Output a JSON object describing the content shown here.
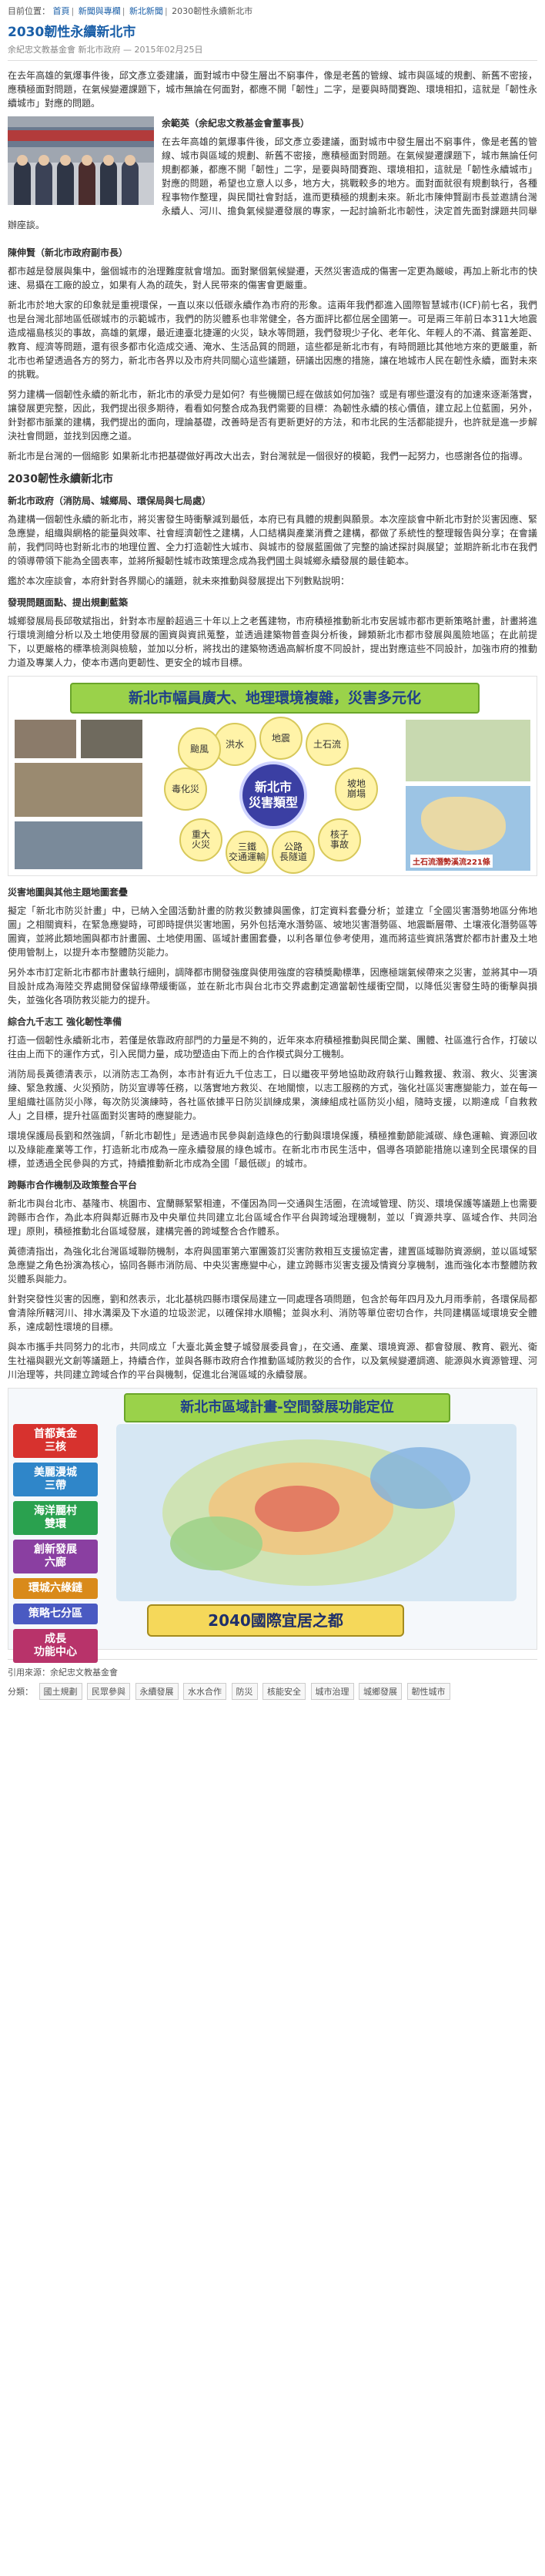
{
  "breadcrumb": {
    "prefix": "目前位置：",
    "items": [
      "首頁",
      "新聞與專欄",
      "新北新聞"
    ],
    "current": "2030韌性永續新北市"
  },
  "article": {
    "title": "2030韌性永續新北市",
    "meta": "余紀忠文教基金會 新北市政府 — 2015年02月25日",
    "intro": "在去年高雄的氣爆事件後，邱文彥立委建議，面對城市中發生層出不窮事件，像是老舊的管線、城市與區域的規劃、新舊不密接，應積極面對問題，在氣候變遷課題下，城市無論在何面對，都應不開「韌性」二字，是要與時間賽跑、環境相扣，這就是「韌性永續城市」對應的問題。",
    "caption": "余範英（余紀忠文教基金會董事長）",
    "para_a": "在去年高雄的氣爆事件後，邱文彥立委建議，面對城市中發生層出不窮事件，像是老舊的管線、城市與區域的規劃、新舊不密接，應積極面對問題。在氣候變遷課題下，城市無論任何規劃都兼，都應不開「韌性」二字，是要與時間賽跑、環境相扣，這就是「韌性永續城市」對應的問題，希望也立意人以多，地方大，挑戰較多的地方。面對面就很有規劃執行，各種程事物作整理，與民間社會對話，進而更積極的規劃未來。新北市陳伸賢副市長並邀請台灣永續人、河川、擔負氣候變遷發展的專家，一起討論新北市韌性，決定首先面對課題共同舉辦座談。",
    "speaker_2": "陳伸賢（新北市政府副市長）",
    "para_b": "都市越是發展與集中，盤個城市的治理難度就會增加。面對聚個氣候變遷，天然災害造成的傷害一定更為嚴峻，再加上新北市的快速、易攝在工廠的設立，如果有人為的疏失，對人民带來的傷害會更嚴重。",
    "para_c": "新北市於地大家的印象就是重視環保，一直以來以低碳永續作為市府的形象。這兩年我們都進入國際智慧城市(ICF)前七名，我們也是台灣北部地區低碳城市的示範城市，我們的防災體系也非常健全，各方面評比都位居全國第一。可是兩三年前日本311大地震造成福島核災的事故，高雄的氣爆，最近連臺北捷運的火災，缺水等問題，我們發現少子化、老年化、年輕人的不滿、貧富差距、教育、經濟等問題，還有很多都市化造成交通、淹水、生活品質的問題，這些都是新北市有，有時問題比其他地方來的更嚴重，新北市也希望透過各方的努力，新北市各界以及市府共同關心這些議題，研議出因應的措施，讓在地城市人民在韌性永續，面對未來的挑戰。",
    "para_d": "努力建構一個韌性永續的新北市，新北市的承受力是如何？有些機關已經在做該如何加強？或是有哪些還沒有的加速來逐漸落實，讓發展更完整，因此，我們提出很多期待，看看如何整合成為我們需要的目標：為韌性永續的核心價值，建立起上位藍圖，另外，針對都市脈業的建構，我們提出的面向，理論基礎，改善時是否有更新更好的方法，和市北民的生活都能提升，也許就是進一步解決社會問題，並找到因應之道。",
    "para_e": "新北市是台灣的一個縮影 如果新北市把基礎做好再改大出去，對台灣就是一個很好的模範，我們一起努力，也感謝各位的指導。",
    "h_2030": "2030韌性永續新北市",
    "h_gov": "新北市政府（消防局、城鄉局、環保局與七局處）",
    "para_f": "為建構一個韌性永續的新北市，將災害發生時衝擊減到最低，本府已有具體的規劃與願景。本次座談會中新北市對於災害因應、緊急應變，組織與網格的能量與效率、社會經濟韌性之建構，人口結構與產業消費之建構，都做了系統性的整理報告與分享；在會議前，我們同時也對新北市的地理位置、全力打造韌性大城市、與城市的發展藍圖做了完整的論述探討與展望；並期許新北市在我們的領導帶領下能為全國表率，並將所擬韌性城市政策理念成為我們國土與城鄉永續發展的最佳範本。",
    "para_g": "鑑於本次座談會，本府針對各界關心的議題，就未來推動與發展提出下列數點說明：",
    "h_dev": "發現問題面點、提出規劃藍築",
    "para_h": "城鄉發展局長邱敬斌指出，針對本市屋齡超過三十年以上之老舊建物，市府積極推動新北市安居城市都市更新策略計畫，計畫將進行環境測繪分析以及土地使用發展的圖資與資訊蒐整，並透過建築物普查與分析後，歸類新北市都市發展與風險地區；在此前提下，以更嚴格的標準檢測與檢驗，並加以分析，將找出的建築物透過高解析度不同設計，提出對應這些不同設計，加強市府的推動力道及專業人力，使本市邁向更韌性、更安全的城市目標。",
    "h_disaster": "災害地圖與其他主題地圖套疊",
    "para_i": "擬定「新北市防災計畫」中，已納入全國活動計畫的防救災數據與圖像，訂定資料套疊分析；並建立「全國災害潛勢地區分佈地圖」之相關資料，在緊急應變時，可即時提供災害地圖，另外包括淹水潛勢區、坡地災害潛勢區、地震斷層帶、土壤液化潛勢區等圖資，並將此類地圖與都市計畫圖、土地使用圖、區域計畫圖套疊，以利各單位參考使用，進而將這些資訊落實於都市計畫及土地使用管制上，以提升本市整體防災能力。",
    "para_j": "另外本市訂定新北市都市計畫執行細則，調降都市開發強度與使用強度的容積獎勵標準，因應極端氣候帶來之災害，並將其中一項目設計成為海陸交界處開發保留綠帶緩衝區，並在新北市與台北市交界處劃定適當韌性緩衝空間，以降低災害發生時的衝擊與損失，並強化各項防救災能力的提升。",
    "h_five": "綜合九千志工 強化韌性準備",
    "para_k": "打造一個韌性永續新北市，若僅是依靠政府部門的力量是不夠的，近年來本府積極推動與民間企業、團體、社區進行合作，打破以往由上而下的運作方式，引入民間力量，成功塑造由下而上的合作模式與分工機制。",
    "para_l": "消防局長黃德清表示，以消防志工為例，本市計有近九千位志工，日以繼夜平勞地協助政府執行山難救援、救溺、救火、災害演練、緊急救護、火災預防，防災宣導等任務，以落實地方救災、在地關懷，以志工服務的方式，強化社區災害應變能力，並在每一里組織社區防災小隊，每次防災演練時，各社區依據平日防災訓練成果，演練組成社區防災小組，隨時支援，以期達成「自救救人」之目標，提升社區面對災害時的應變能力。",
    "para_m": "環境保護局長劉和然強調，「新北市韌性」是透過市民參與創造綠色的行動與環境保護，積極推動節能減碳、綠色運輸、資源回收以及綠能產業等工作，打造新北市成為一座永續發展的綠色城市。在新北市市民生活中，倡導各項節能措施以達到全民環保的目標，並透過全民參與的方式，持續推動新北市成為全國「最低碳」的城市。",
    "h_cross": "跨縣市合作機制及政策整合平台",
    "para_n": "新北市與台北市、基隆市、桃園市、宜蘭縣緊緊相連，不僅因為同一交通與生活圈，在流域管理、防災、環境保護等議題上也需要跨縣市合作，為此本府與鄰近縣市及中央單位共同建立北台區域合作平台與跨域治理機制，並以「資源共享、區域合作、共同治理」原則，積極推動北台區域發展，建構完善的跨域整合合作體系。",
    "para_o": "黃德清指出，為強化北台灣區域聯防機制，本府與國軍第六軍團簽訂災害防救相互支援協定書，建置區域聯防資源網，並以區域緊急應變之角色扮演為核心，協同各縣市消防局、中央災害應變中心，建立跨縣市災害支援及情資分享機制，進而強化本市整體防救災體系與能力。",
    "para_p": "針對突發性災害的因應，劉和然表示，北北基桃四縣市環保局建立一同處理各項問題，包含於每年四月及九月雨季前，各環保局都會清除所轄河川、排水溝渠及下水道的垃圾淤泥，以確保排水順暢；並與水利、消防等單位密切合作，共同建構區域環境安全體系，達成韌性環境的目標。",
    "para_q": "與本市攜手共同努力的北市，共同成立「大臺北黃金雙子城發展委員會」，在交通、產業、環境資源、都會發展、教育、觀光、衛生社福與觀光文創等議題上，持續合作，並與各縣市政府合作推動區域防救災的合作，以及氣候變遷調適、能源與水資源管理、河川治理等，共同建立跨域合作的平台與機制，促進北台灣區域的永續發展。"
  },
  "fig1": {
    "banner": "新北市幅員廣大、地理環境複雜，災害多元化",
    "center": "新北市\n災害類型",
    "petals": [
      "洪水",
      "地震",
      "土石流",
      "坡地\n崩塌",
      "核子\n事故",
      "公路\n長隧道",
      "三鐵\n交通運輸",
      "重大\n火災",
      "毒化災",
      "颱風"
    ],
    "caption_right": "土石流潛勢溪流221條"
  },
  "fig2": {
    "banner": "新北市區域計畫-空間發展功能定位",
    "labels": [
      {
        "text": "首都黃金\n三核",
        "color": "#d7322e"
      },
      {
        "text": "美麗漫城\n三帶",
        "color": "#2f86c9"
      },
      {
        "text": "海洋麗村\n雙環",
        "color": "#2aa14f"
      },
      {
        "text": "創新發展\n六廊",
        "color": "#8a3fa1"
      },
      {
        "text": "環城六綠鏈",
        "color": "#d98a1a"
      },
      {
        "text": "策略七分區",
        "color": "#4a5ac2"
      },
      {
        "text": "成長\n功能中心",
        "color": "#b8336a"
      }
    ],
    "footer": "2040國際宜居之都"
  },
  "tags": {
    "label": "引用來源：余紀忠文教基金會",
    "items_label": "分類：",
    "items": [
      "國土規劃",
      "民眾參與",
      "永續發展",
      "水水合作",
      "防災",
      "核能安全",
      "城市治理",
      "城鄉發展",
      "韌性城市"
    ]
  }
}
